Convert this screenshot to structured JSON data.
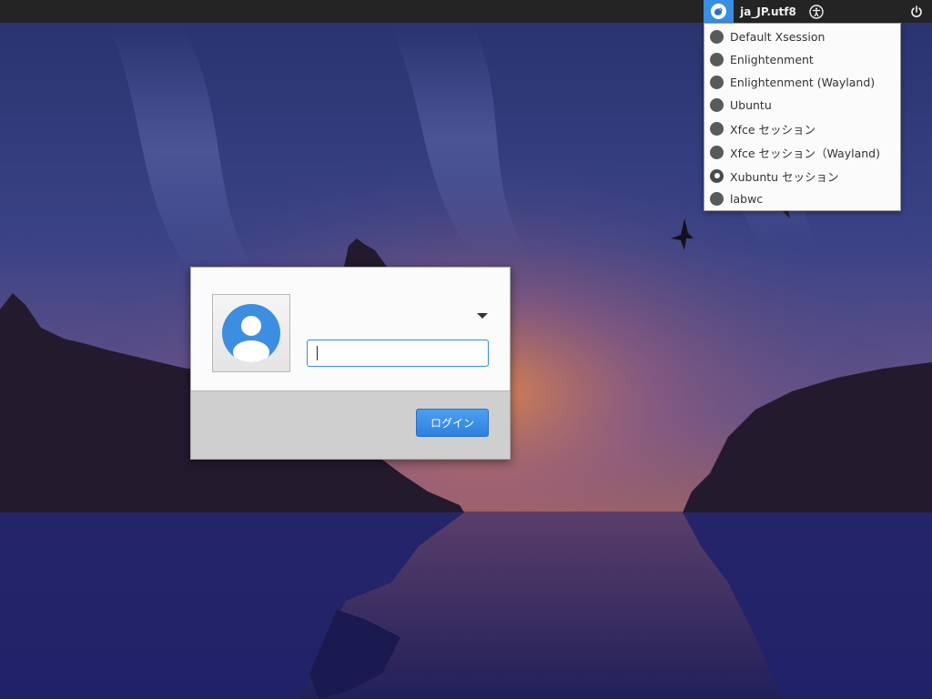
{
  "panel": {
    "language": "ja_JP.utf8"
  },
  "session_menu": {
    "items": [
      {
        "label": "Default Xsession",
        "selected": false
      },
      {
        "label": "Enlightenment",
        "selected": false
      },
      {
        "label": "Enlightenment (Wayland)",
        "selected": false
      },
      {
        "label": "Ubuntu",
        "selected": false
      },
      {
        "label": "Xfce セッション",
        "selected": false
      },
      {
        "label": "Xfce セッション（Wayland)",
        "selected": false
      },
      {
        "label": "Xubuntu セッション",
        "selected": true
      },
      {
        "label": "labwc",
        "selected": false
      }
    ]
  },
  "login": {
    "password_value": "",
    "login_label": "ログイン"
  },
  "icons": {
    "session": "xfce-mouse-icon",
    "accessibility": "accessibility-icon",
    "power": "power-icon",
    "avatar": "user-avatar-icon",
    "dropdown": "triangle-down-icon"
  },
  "colors": {
    "panel_bg": "#242424",
    "accent": "#3a8fe0",
    "menu_bg": "#fbfbfb",
    "dialog_bg": "#fbfbfb",
    "dialog_footer": "#cfcfcf",
    "avatar_blue": "#3d8ee0"
  }
}
